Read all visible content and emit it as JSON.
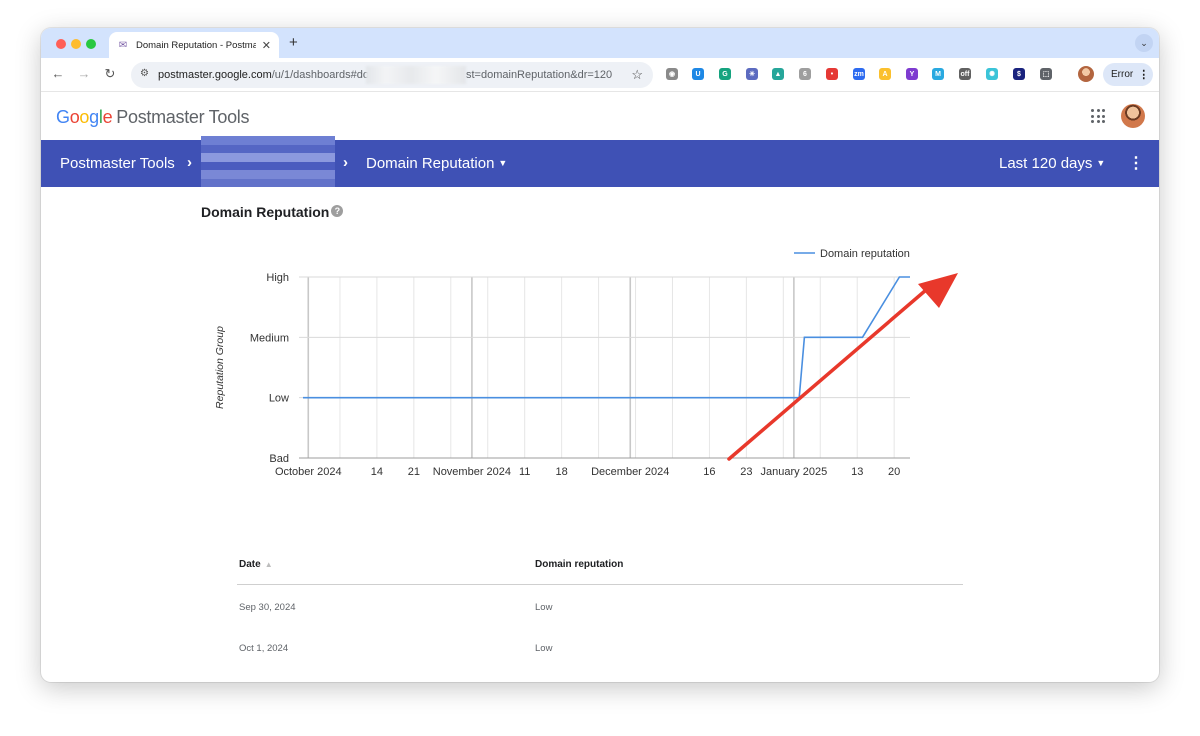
{
  "browser": {
    "tab_title": "Domain Reputation - Postmaster Tools",
    "tab_favicon": "postmaster-icon",
    "url_host": "postmaster.google.com",
    "url_path_start": "/u/1/dashboards#do=",
    "url_path_end": "st=domainReputation&dr=120",
    "profile_status": "Error",
    "extensions": [
      {
        "name": "camera-icon",
        "color": "#8a8a8a",
        "glyph": "◉"
      },
      {
        "name": "u-extension-icon",
        "color": "#1e88e5",
        "glyph": "U"
      },
      {
        "name": "grammarly-icon",
        "color": "#15a37f",
        "glyph": "G"
      },
      {
        "name": "snowflake-icon",
        "color": "#5c6bc0",
        "glyph": "✳"
      },
      {
        "name": "map-icon",
        "color": "#26a69a",
        "glyph": "▲"
      },
      {
        "name": "box-icon",
        "color": "#9e9e9e",
        "glyph": "6"
      },
      {
        "name": "lastpass-icon",
        "color": "#e53935",
        "glyph": "•"
      },
      {
        "name": "zoom-icon",
        "color": "#2d6bf0",
        "glyph": "zm"
      },
      {
        "name": "alert-icon",
        "color": "#fbc02d",
        "glyph": "A"
      },
      {
        "name": "yahoo-icon",
        "color": "#7e3bd0",
        "glyph": "Y"
      },
      {
        "name": "m-extension-icon",
        "color": "#29a9e0",
        "glyph": "M"
      },
      {
        "name": "toggle-off-icon",
        "color": "#616161",
        "glyph": "off"
      },
      {
        "name": "react-icon",
        "color": "#3bc4d8",
        "glyph": "✺"
      },
      {
        "name": "shield-extension-icon",
        "color": "#1a237e",
        "glyph": "$"
      },
      {
        "name": "puzzle-icon",
        "color": "#5f6368",
        "glyph": "⬚"
      }
    ]
  },
  "header": {
    "logo_letters": [
      "G",
      "o",
      "o",
      "g",
      "l",
      "e"
    ],
    "product_name": "Postmaster Tools"
  },
  "nav": {
    "root": "Postmaster Tools",
    "dashboard": "Domain Reputation",
    "range": "Last 120 days"
  },
  "section_title": "Domain Reputation",
  "chart_data": {
    "type": "line",
    "series": [
      {
        "name": "Domain reputation",
        "color": "#4a8fe0",
        "points": [
          [
            "2024-09-30",
            "Low"
          ],
          [
            "2025-01-02",
            "Low"
          ],
          [
            "2025-01-03",
            "Medium"
          ],
          [
            "2025-01-14",
            "Medium"
          ],
          [
            "2025-01-21",
            "High"
          ],
          [
            "2025-01-23",
            "High"
          ]
        ]
      }
    ],
    "y_categories": [
      "Bad",
      "Low",
      "Medium",
      "High"
    ],
    "ylabel": "Reputation Group",
    "x_ticks": [
      "October 2024",
      "14",
      "21",
      "November 2024",
      "11",
      "18",
      "December 2024",
      "16",
      "23",
      "January 2025",
      "13",
      "20"
    ],
    "xlim": [
      "2024-09-30",
      "2025-01-23"
    ],
    "legend_position": "top-right",
    "grid": true,
    "annotation": {
      "type": "arrow",
      "color": "#e8382b"
    }
  },
  "table": {
    "columns": [
      "Date",
      "Domain reputation"
    ],
    "rows": [
      [
        "Sep 30, 2024",
        "Low"
      ],
      [
        "Oct 1, 2024",
        "Low"
      ]
    ]
  }
}
